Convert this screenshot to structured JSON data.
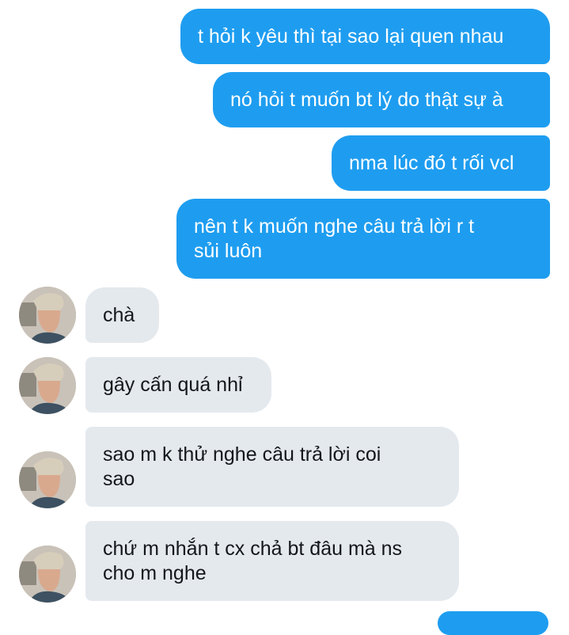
{
  "messages": [
    {
      "sender": "me",
      "text": "t hỏi k yêu thì tại sao lại quen nhau"
    },
    {
      "sender": "me",
      "text": "nó hỏi t muốn bt lý do thật sự à"
    },
    {
      "sender": "me",
      "text": "nma lúc đó t rối vcl"
    },
    {
      "sender": "me",
      "text": "nên t k muốn nghe câu trả lời r t\nsủi luôn"
    },
    {
      "sender": "other",
      "text": "chà"
    },
    {
      "sender": "other",
      "text": "gây cấn quá nhỉ"
    },
    {
      "sender": "other",
      "text": "sao m k thử nghe câu trả lời coi\nsao"
    },
    {
      "sender": "other",
      "text": "chứ m nhắn t cx chả bt đâu mà ns\ncho m nghe"
    }
  ],
  "colors": {
    "outgoing_bubble": "#1e9df0",
    "incoming_bubble": "#e4e9ee",
    "background": "#ffffff"
  }
}
